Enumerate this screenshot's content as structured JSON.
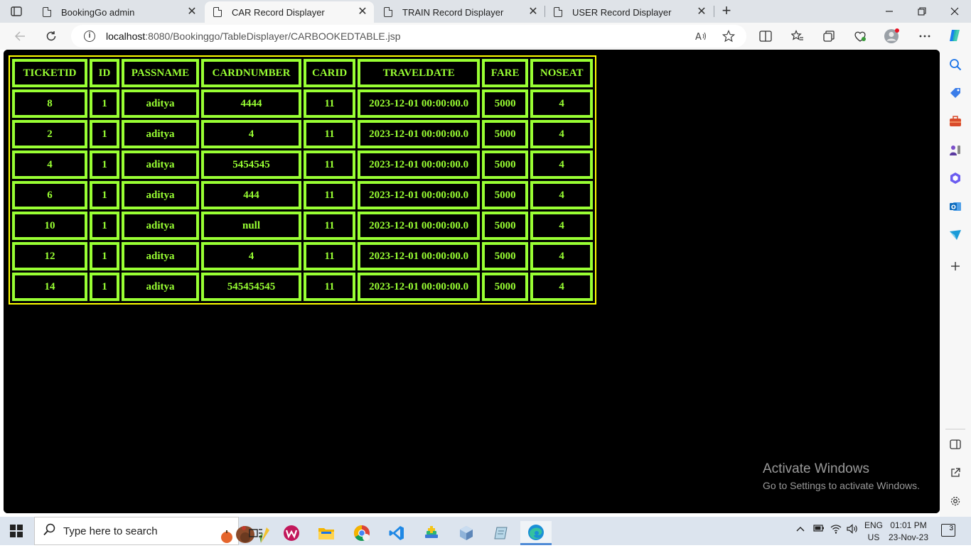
{
  "browser": {
    "tabs": [
      {
        "title": "BookingGo admin",
        "active": false
      },
      {
        "title": "CAR Record Displayer",
        "active": true
      },
      {
        "title": "TRAIN Record Displayer",
        "active": false
      },
      {
        "title": "USER Record Displayer",
        "active": false
      }
    ],
    "tab_close_glyph": "✕",
    "new_tab_glyph": "+",
    "url_host": "localhost",
    "url_rest": ":8080/Bookinggo/TableDisplayer/CARBOOKEDTABLE.jsp",
    "info_glyph": "i"
  },
  "table": {
    "headers": [
      "TICKETID",
      "ID",
      "PASSNAME",
      "CARDNUMBER",
      "CARID",
      "TRAVELDATE",
      "FARE",
      "NOSEAT"
    ],
    "rows": [
      [
        "8",
        "1",
        "aditya",
        "4444",
        "11",
        "2023-12-01 00:00:00.0",
        "5000",
        "4"
      ],
      [
        "2",
        "1",
        "aditya",
        "4",
        "11",
        "2023-12-01 00:00:00.0",
        "5000",
        "4"
      ],
      [
        "4",
        "1",
        "aditya",
        "5454545",
        "11",
        "2023-12-01 00:00:00.0",
        "5000",
        "4"
      ],
      [
        "6",
        "1",
        "aditya",
        "444",
        "11",
        "2023-12-01 00:00:00.0",
        "5000",
        "4"
      ],
      [
        "10",
        "1",
        "aditya",
        "null",
        "11",
        "2023-12-01 00:00:00.0",
        "5000",
        "4"
      ],
      [
        "12",
        "1",
        "aditya",
        "4",
        "11",
        "2023-12-01 00:00:00.0",
        "5000",
        "4"
      ],
      [
        "14",
        "1",
        "aditya",
        "545454545",
        "11",
        "2023-12-01 00:00:00.0",
        "5000",
        "4"
      ]
    ],
    "colors": {
      "text": "#99ff33",
      "cell_border": "#99ff33",
      "outer_border": "#ffff00",
      "background": "#000000"
    }
  },
  "watermark": {
    "line1": "Activate Windows",
    "line2": "Go to Settings to activate Windows."
  },
  "taskbar": {
    "search_placeholder": "Type here to search",
    "lang_line1": "ENG",
    "lang_line2": "US",
    "time": "01:01 PM",
    "date": "23-Nov-23",
    "notification_count": "3"
  }
}
